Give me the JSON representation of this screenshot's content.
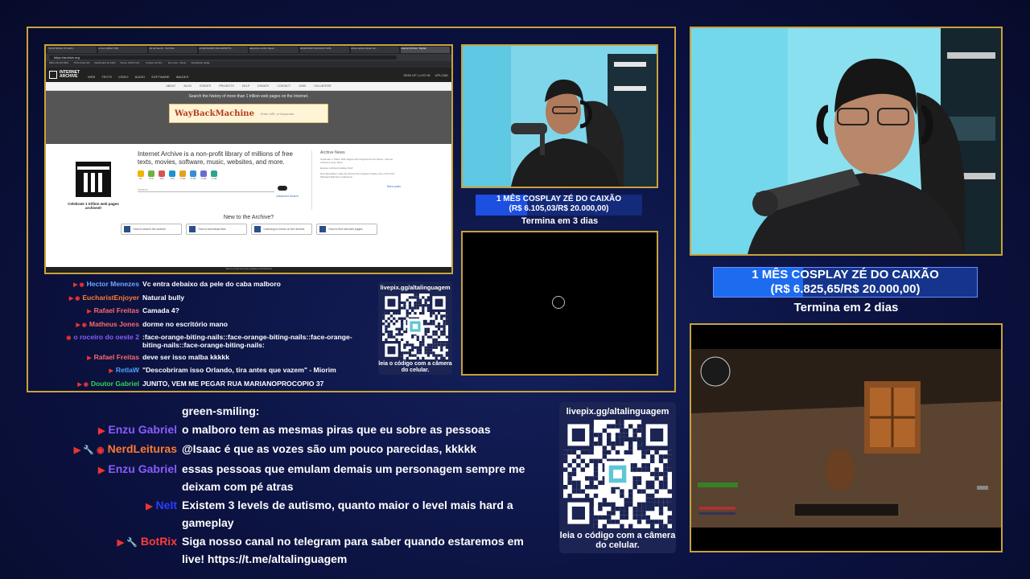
{
  "browser": {
    "tabs": [
      "Yhoshi Mother 2h Gabri...",
      "current [Diffie 5:00]",
      "Mix de favorit - YouTube",
      "ALTERNANDO DE ESPIRITO...",
      "Especulo ao Rio Sauer...",
      "MIGRANDO ANUNCIO SUB...",
      "Robos artiscumpatu am...",
      "Internet Archive: Digital..."
    ],
    "active_tab": 7,
    "url": "https://archive.org",
    "bookmarks": [
      "NBA-LDI-SO-NBA",
      "TOS-Uniao Nili",
      "Dashboard de Stillo",
      "Simon LDIO2 Ulti...",
      "Arquivo de Stil...",
      "De Lucia - Saver",
      "Significado dolga..."
    ],
    "ia_logo": "INTERNET\nARCHIVE",
    "ia_nav": [
      "WEB",
      "TEXTS",
      "VIDEO",
      "AUDIO",
      "SOFTWARE",
      "IMAGES"
    ],
    "ia_right": [
      "SIGN UP | LOG IN",
      "UPLOAD"
    ],
    "ia_sub": [
      "ABOUT",
      "BLOG",
      "EVENTS",
      "PROJECTS",
      "HELP",
      "DONATE",
      "CONTACT",
      "JOBS",
      "VOLUNTEER"
    ],
    "hero_text": "Search the history of more than 1 trillion web pages on the Internet.",
    "wayback_logo": "WayBackMachine",
    "wayback_placeholder": "Enter URL or keywords",
    "temple_caption": "Celebrate 1 trillion web pages archived!",
    "mission": "Internet Archive is a non-profit library of millions of free texts, movies, software, music, websites, and more.",
    "icon_counts": [
      "51",
      "879",
      "184",
      "160",
      "1.6M",
      "6.3M",
      "4.9M",
      "1.3M"
    ],
    "search_placeholder": "Search",
    "advanced_search": "Advanced Search",
    "news_title": "Archive News",
    "news_lines": [
      "Celebrate 1 Trillion Web Pages with Original Fan Art Merch, Internet Archive's Cozy Store",
      "Explore Archived Holiday Stuff",
      "New Revelation: Help the Endowment Helped Create One of the First Wayback Machine Collections"
    ],
    "more_posts": "More posts",
    "new_to_archive": "New to the Archive?",
    "cards": [
      "How to search the archive",
      "How to download files",
      "Listening to music on the archive",
      "How to find lost web pages"
    ],
    "footer": "Terms of Service (last updated 12/31/2014)"
  },
  "goal_small": {
    "title": "1 MÊS COSPLAY ZÉ DO CAIXÃO",
    "amount": "(R$ 6.105,03/R$ 20.000,00)",
    "progress": 0.31,
    "ends": "Termina em 3 dias"
  },
  "goal_large": {
    "title": "1 MÊS COSPLAY ZÉ DO CAIXÃO",
    "amount": "(R$ 6.825,65/R$ 20.000,00)",
    "progress": 0.34,
    "ends": "Termina em 2 dias"
  },
  "chat_small": [
    {
      "name": "Hector Menezes",
      "color": "#6aa8ff",
      "icons": "▶ ◉",
      "msg": "Vc entra debaixo da pele do caba malboro"
    },
    {
      "name": "EucharistEnjoyer",
      "color": "#ff7a2e",
      "icons": "▶ ◉",
      "msg": "Natural bully"
    },
    {
      "name": "Rafael Freitas",
      "color": "#ff6a6a",
      "icons": "▶",
      "msg": "Camada 4?"
    },
    {
      "name": "Matheus Jones",
      "color": "#ff6a6a",
      "icons": "▶ ◉",
      "msg": "dorme no escritório mano"
    },
    {
      "name": "o roceiro do oeste 2",
      "color": "#8a5cff",
      "icons": "◉",
      "msg": ":face-orange-biting-nails::face-orange-biting-nails::face-orange-biting-nails::face-orange-biting-nails:"
    },
    {
      "name": "Rafael Freitas",
      "color": "#ff6a6a",
      "icons": "▶",
      "msg": "deve ser isso malba kkkkk"
    },
    {
      "name": "RetlaW",
      "color": "#4fa3ff",
      "icons": "▶",
      "msg": "\"Descobriram isso Orlando, tira antes que vazem\" - Miorim"
    },
    {
      "name": "Doutor Gabriel",
      "color": "#39d353",
      "icons": "▶ ◉",
      "msg": "JUNITO, VEM ME PEGAR RUA MARIANOPROCOPIO 37"
    }
  ],
  "chat_big": [
    {
      "name": "",
      "color": "#ffffff",
      "icons": "",
      "msg": "green-smiling:"
    },
    {
      "name": "Enzu Gabriel",
      "color": "#8a5cff",
      "icons": "▶",
      "msg": "o malboro tem as mesmas piras que eu sobre as pessoas"
    },
    {
      "name": "NerdLeituras",
      "color": "#ff7a2e",
      "icons": "▶ 🔧 ◉",
      "msg": "@Isaac é que as vozes são um pouco parecidas, kkkkk"
    },
    {
      "name": "Enzu Gabriel",
      "color": "#8a5cff",
      "icons": "▶",
      "msg": "essas pessoas que emulam demais um personagem sempre me deixam com pé atras"
    },
    {
      "name": "NeIt",
      "color": "#2a3cff",
      "icons": "▶",
      "msg": "Existem 3 levels de autismo, quanto maior o level mais hard a gameplay"
    },
    {
      "name": "BotRix",
      "color": "#ff3b3b",
      "icons": "▶ 🔧",
      "msg": "Siga nosso canal no telegram para saber quando estaremos em live! https://t.me/altalinguagem"
    }
  ],
  "qr_small": {
    "url": "livepix.gg/altalinguagem",
    "caption": "leia o código com a câmera do celular."
  },
  "qr_big": {
    "url": "livepix.gg/altalinguagem",
    "caption": "leia o código com a câmera do celular."
  },
  "colors": {
    "frame": "#c9a23a",
    "background": "#0b1240",
    "goal_fill": "#1d4fe0"
  }
}
